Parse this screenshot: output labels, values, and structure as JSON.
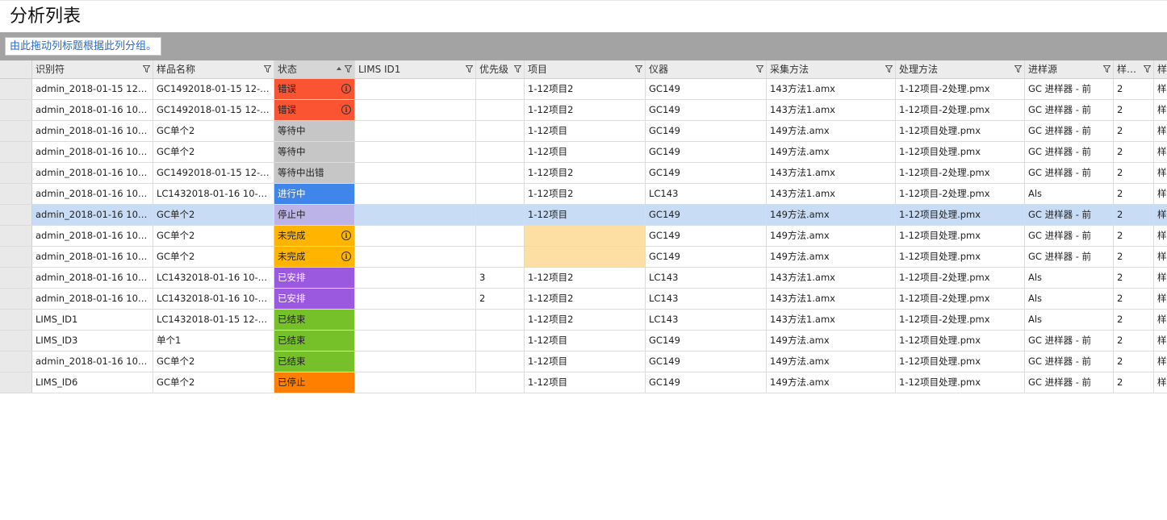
{
  "page": {
    "title": "分析列表"
  },
  "grouping": {
    "hint": "由此拖动列标题根据此列分组。"
  },
  "colors": {
    "error": "#fb5433",
    "waiting": "#c6c6c6",
    "running": "#3f85ea",
    "stopping": "#bcb3e7",
    "incomplete": "#ffb400",
    "scheduled": "#9b59e0",
    "finished": "#76c12a",
    "stopped": "#ff7f00",
    "empty_project": "#fddfa3",
    "selected_row": "#c8dcf5"
  },
  "columns": [
    "识别符",
    "样品名称",
    "状态",
    "LIMS ID1",
    "优先级",
    "项目",
    "仪器",
    "采集方法",
    "处理方法",
    "进样源",
    "样品瓶",
    "样品"
  ],
  "rows": [
    {
      "id": "admin_2018-01-15 12-...",
      "sample": "GC1492018-01-15 12-1...",
      "status": "错误",
      "status_key": "error",
      "info": true,
      "lims": "",
      "priority": "",
      "project": "1-12项目2",
      "instrument": "GC149",
      "acq": "143方法1.amx",
      "proc": "1-12项目-2处理.pmx",
      "source": "GC 进样器 - 前",
      "vial": "2",
      "extra": "样品"
    },
    {
      "id": "admin_2018-01-16 10-...",
      "sample": "GC1492018-01-15 12-1...",
      "status": "错误",
      "status_key": "error",
      "info": true,
      "lims": "",
      "priority": "",
      "project": "1-12项目2",
      "instrument": "GC149",
      "acq": "143方法1.amx",
      "proc": "1-12项目-2处理.pmx",
      "source": "GC 进样器 - 前",
      "vial": "2",
      "extra": "样品"
    },
    {
      "id": "admin_2018-01-16 10-...",
      "sample": "GC单个2",
      "status": "等待中",
      "status_key": "waiting",
      "info": false,
      "lims": "",
      "priority": "",
      "project": "1-12项目",
      "instrument": "GC149",
      "acq": "149方法.amx",
      "proc": "1-12项目处理.pmx",
      "source": "GC 进样器 - 前",
      "vial": "2",
      "extra": "样品"
    },
    {
      "id": "admin_2018-01-16 10-...",
      "sample": "GC单个2",
      "status": "等待中",
      "status_key": "waiting",
      "info": false,
      "lims": "",
      "priority": "",
      "project": "1-12项目",
      "instrument": "GC149",
      "acq": "149方法.amx",
      "proc": "1-12项目处理.pmx",
      "source": "GC 进样器 - 前",
      "vial": "2",
      "extra": "样品"
    },
    {
      "id": "admin_2018-01-16 10-...",
      "sample": "GC1492018-01-15 12-1...",
      "status": "等待中出错",
      "status_key": "waiting",
      "info": false,
      "lims": "",
      "priority": "",
      "project": "1-12项目2",
      "instrument": "GC149",
      "acq": "143方法1.amx",
      "proc": "1-12项目-2处理.pmx",
      "source": "GC 进样器 - 前",
      "vial": "2",
      "extra": "样品"
    },
    {
      "id": "admin_2018-01-16 10-...",
      "sample": "LC1432018-01-16 10-5...",
      "status": "进行中",
      "status_key": "running",
      "info": false,
      "lims": "",
      "priority": "",
      "project": "1-12项目2",
      "instrument": "LC143",
      "acq": "143方法1.amx",
      "proc": "1-12项目-2处理.pmx",
      "source": "Als",
      "vial": "2",
      "extra": "样品"
    },
    {
      "id": "admin_2018-01-16 10-...",
      "sample": "GC单个2",
      "status": "停止中",
      "status_key": "stopping",
      "info": false,
      "lims": "",
      "priority": "",
      "project": "1-12项目",
      "instrument": "GC149",
      "acq": "149方法.amx",
      "proc": "1-12项目处理.pmx",
      "source": "GC 进样器 - 前",
      "vial": "2",
      "extra": "样品",
      "selected": true
    },
    {
      "id": "admin_2018-01-16 10-...",
      "sample": "GC单个2",
      "status": "未完成",
      "status_key": "incomplete",
      "info": true,
      "lims": "",
      "priority": "",
      "project": "",
      "empty_project": true,
      "instrument": "GC149",
      "acq": "149方法.amx",
      "proc": "1-12项目处理.pmx",
      "source": "GC 进样器 - 前",
      "vial": "2",
      "extra": "样品"
    },
    {
      "id": "admin_2018-01-16 10-...",
      "sample": "GC单个2",
      "status": "未完成",
      "status_key": "incomplete",
      "info": true,
      "lims": "",
      "priority": "",
      "project": "",
      "empty_project": true,
      "instrument": "GC149",
      "acq": "149方法.amx",
      "proc": "1-12项目处理.pmx",
      "source": "GC 进样器 - 前",
      "vial": "2",
      "extra": "样品"
    },
    {
      "id": "admin_2018-01-16 10-...",
      "sample": "LC1432018-01-16 10-5...",
      "status": "已安排",
      "status_key": "scheduled",
      "info": false,
      "lims": "",
      "priority": "3",
      "project": "1-12项目2",
      "instrument": "LC143",
      "acq": "143方法1.amx",
      "proc": "1-12项目-2处理.pmx",
      "source": "Als",
      "vial": "2",
      "extra": "样品"
    },
    {
      "id": "admin_2018-01-16 10-...",
      "sample": "LC1432018-01-16 10-5...",
      "status": "已安排",
      "status_key": "scheduled",
      "info": false,
      "lims": "",
      "priority": "2",
      "project": "1-12项目2",
      "instrument": "LC143",
      "acq": "143方法1.amx",
      "proc": "1-12项目-2处理.pmx",
      "source": "Als",
      "vial": "2",
      "extra": "样品"
    },
    {
      "id": "LIMS_ID1",
      "sample": "LC1432018-01-15 12-1...",
      "status": "已结束",
      "status_key": "finished",
      "info": false,
      "lims": "",
      "priority": "",
      "project": "1-12项目2",
      "instrument": "LC143",
      "acq": "143方法1.amx",
      "proc": "1-12项目-2处理.pmx",
      "source": "Als",
      "vial": "2",
      "extra": "样品"
    },
    {
      "id": "LIMS_ID3",
      "sample": "单个1",
      "status": "已结束",
      "status_key": "finished",
      "info": false,
      "lims": "",
      "priority": "",
      "project": "1-12项目",
      "instrument": "GC149",
      "acq": "149方法.amx",
      "proc": "1-12项目处理.pmx",
      "source": "GC 进样器 - 前",
      "vial": "2",
      "extra": "样品"
    },
    {
      "id": "admin_2018-01-16 10-...",
      "sample": "GC单个2",
      "status": "已结束",
      "status_key": "finished",
      "info": false,
      "lims": "",
      "priority": "",
      "project": "1-12项目",
      "instrument": "GC149",
      "acq": "149方法.amx",
      "proc": "1-12项目处理.pmx",
      "source": "GC 进样器 - 前",
      "vial": "2",
      "extra": "样品"
    },
    {
      "id": "LIMS_ID6",
      "sample": "GC单个2",
      "status": "已停止",
      "status_key": "stopped",
      "info": false,
      "lims": "",
      "priority": "",
      "project": "1-12项目",
      "instrument": "GC149",
      "acq": "149方法.amx",
      "proc": "1-12项目处理.pmx",
      "source": "GC 进样器 - 前",
      "vial": "2",
      "extra": "样品"
    }
  ]
}
